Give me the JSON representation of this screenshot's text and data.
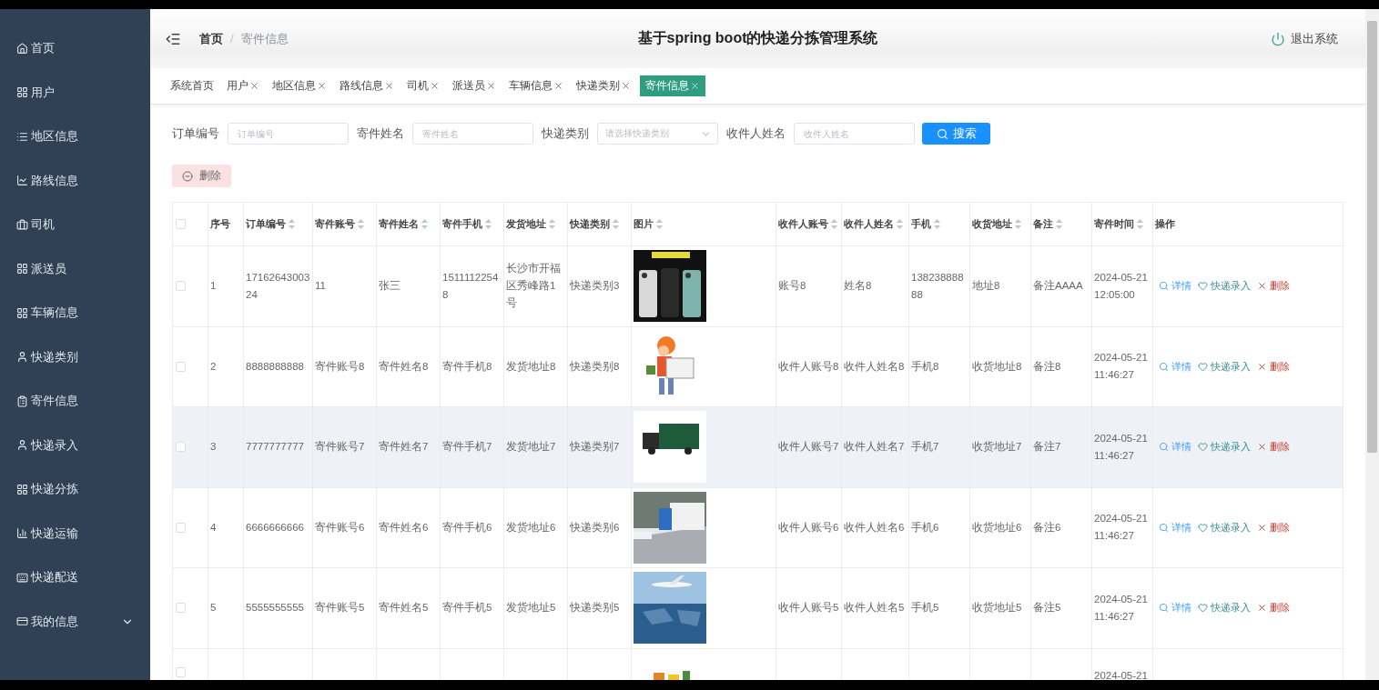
{
  "sidebar": {
    "items": [
      {
        "label": "首页",
        "selected": false
      },
      {
        "label": "用户",
        "selected": false
      },
      {
        "label": "地区信息",
        "selected": false
      },
      {
        "label": "路线信息",
        "selected": false
      },
      {
        "label": "司机",
        "selected": false
      },
      {
        "label": "派送员",
        "selected": false
      },
      {
        "label": "车辆信息",
        "selected": false
      },
      {
        "label": "快递类别",
        "selected": false
      },
      {
        "label": "寄件信息",
        "selected": false
      },
      {
        "label": "快递录入",
        "selected": false
      },
      {
        "label": "快递分拣",
        "selected": false
      },
      {
        "label": "快递运输",
        "selected": false
      },
      {
        "label": "快递配送",
        "selected": false
      },
      {
        "label": "我的信息",
        "selected": false,
        "expanded": false
      }
    ]
  },
  "header": {
    "breadcrumb": [
      "首页",
      "寄件信息"
    ],
    "breadcrumb_separator": "/",
    "title": "基于spring boot的快递分拣管理系统",
    "logout": "退出系统"
  },
  "tabs": [
    {
      "label": "系统首页",
      "closable": false,
      "selected": false
    },
    {
      "label": "用户",
      "closable": true,
      "selected": false
    },
    {
      "label": "地区信息",
      "closable": true,
      "selected": false
    },
    {
      "label": "路线信息",
      "closable": true,
      "selected": false
    },
    {
      "label": "司机",
      "closable": true,
      "selected": false
    },
    {
      "label": "派送员",
      "closable": true,
      "selected": false
    },
    {
      "label": "车辆信息",
      "closable": true,
      "selected": false
    },
    {
      "label": "快递类别",
      "closable": true,
      "selected": false
    },
    {
      "label": "寄件信息",
      "closable": true,
      "selected": true
    }
  ],
  "search": {
    "fields": [
      {
        "kind": "input",
        "label": "订单编号",
        "placeholder": "订单编号"
      },
      {
        "kind": "input",
        "label": "寄件姓名",
        "placeholder": "寄件姓名"
      },
      {
        "kind": "select",
        "label": "快递类别",
        "placeholder": "请选择快递类别"
      },
      {
        "kind": "input",
        "label": "收件人姓名",
        "placeholder": "收件人姓名"
      }
    ],
    "button": "搜索"
  },
  "bulk_delete": "删除",
  "table": {
    "select_all_checked": false,
    "columns": [
      {
        "label": "序号",
        "kind": "text",
        "sortable": false
      },
      {
        "label": "订单编号",
        "kind": "text",
        "sortable": true
      },
      {
        "label": "寄件账号",
        "kind": "text",
        "sortable": true
      },
      {
        "label": "寄件姓名",
        "kind": "text",
        "sortable": true
      },
      {
        "label": "寄件手机",
        "kind": "text",
        "sortable": true
      },
      {
        "label": "发货地址",
        "kind": "text",
        "sortable": true
      },
      {
        "label": "快递类别",
        "kind": "text",
        "sortable": true
      },
      {
        "label": "图片",
        "sortable": true
      },
      {
        "label": "收件人账号",
        "kind": "text",
        "sortable": true
      },
      {
        "label": "收件人姓名",
        "kind": "text",
        "sortable": true
      },
      {
        "label": "手机",
        "kind": "text",
        "sortable": true
      },
      {
        "label": "收货地址",
        "kind": "text",
        "sortable": true
      },
      {
        "label": "备注",
        "kind": "text",
        "sortable": true
      },
      {
        "label": "寄件时间",
        "kind": "text",
        "sortable": true
      },
      {
        "label": "操作",
        "kind": "actions",
        "sortable": false
      }
    ],
    "rows": [
      {
        "checked": false,
        "hovered": false,
        "cells": [
          "1",
          "1716264300324",
          "11",
          "张三",
          "15111122548",
          "长沙市开福区秀峰路1号",
          "快递类别3",
          {
            "kind": "picture"
          },
          "账号8",
          "姓名8",
          "13823888888",
          "地址8",
          "备注AAAA",
          "2024-05-21 12:05:00",
          [
            {
              "kind": "detail",
              "label": "详情"
            },
            {
              "kind": "entry",
              "label": "快递录入"
            },
            {
              "kind": "delete",
              "label": "删除"
            }
          ]
        ]
      },
      {
        "checked": false,
        "hovered": false,
        "cells": [
          "2",
          "8888888888",
          "寄件账号8",
          "寄件姓名8",
          "寄件手机8",
          "发货地址8",
          "快递类别8",
          {
            "kind": "picture"
          },
          "收件人账号8",
          "收件人姓名8",
          "手机8",
          "收货地址8",
          "备注8",
          "2024-05-21 11:46:27",
          [
            {
              "kind": "detail",
              "label": "详情"
            },
            {
              "kind": "entry",
              "label": "快递录入"
            },
            {
              "kind": "delete",
              "label": "删除"
            }
          ]
        ]
      },
      {
        "checked": false,
        "hovered": true,
        "cells": [
          "3",
          "7777777777",
          "寄件账号7",
          "寄件姓名7",
          "寄件手机7",
          "发货地址7",
          "快递类别7",
          {
            "kind": "picture"
          },
          "收件人账号7",
          "收件人姓名7",
          "手机7",
          "收货地址7",
          "备注7",
          "2024-05-21 11:46:27",
          [
            {
              "kind": "detail",
              "label": "详情"
            },
            {
              "kind": "entry",
              "label": "快递录入"
            },
            {
              "kind": "delete",
              "label": "删除"
            }
          ]
        ]
      },
      {
        "checked": false,
        "hovered": false,
        "cells": [
          "4",
          "6666666666",
          "寄件账号6",
          "寄件姓名6",
          "寄件手机6",
          "发货地址6",
          "快递类别6",
          {
            "kind": "picture"
          },
          "收件人账号6",
          "收件人姓名6",
          "手机6",
          "收货地址6",
          "备注6",
          "2024-05-21 11:46:27",
          [
            {
              "kind": "detail",
              "label": "详情"
            },
            {
              "kind": "entry",
              "label": "快递录入"
            },
            {
              "kind": "delete",
              "label": "删除"
            }
          ]
        ]
      },
      {
        "checked": false,
        "hovered": false,
        "cells": [
          "5",
          "5555555555",
          "寄件账号5",
          "寄件姓名5",
          "寄件手机5",
          "发货地址5",
          "快递类别5",
          {
            "kind": "picture"
          },
          "收件人账号5",
          "收件人姓名5",
          "手机5",
          "收货地址5",
          "备注5",
          "2024-05-21 11:46:27",
          [
            {
              "kind": "detail",
              "label": "详情"
            },
            {
              "kind": "entry",
              "label": "快递录入"
            },
            {
              "kind": "delete",
              "label": "删除"
            }
          ]
        ]
      },
      {
        "checked": false,
        "hovered": false,
        "cells": [
          null,
          null,
          null,
          null,
          null,
          null,
          null,
          {
            "kind": "picture"
          },
          null,
          null,
          null,
          null,
          null,
          "2024-05-21",
          null
        ]
      }
    ]
  }
}
